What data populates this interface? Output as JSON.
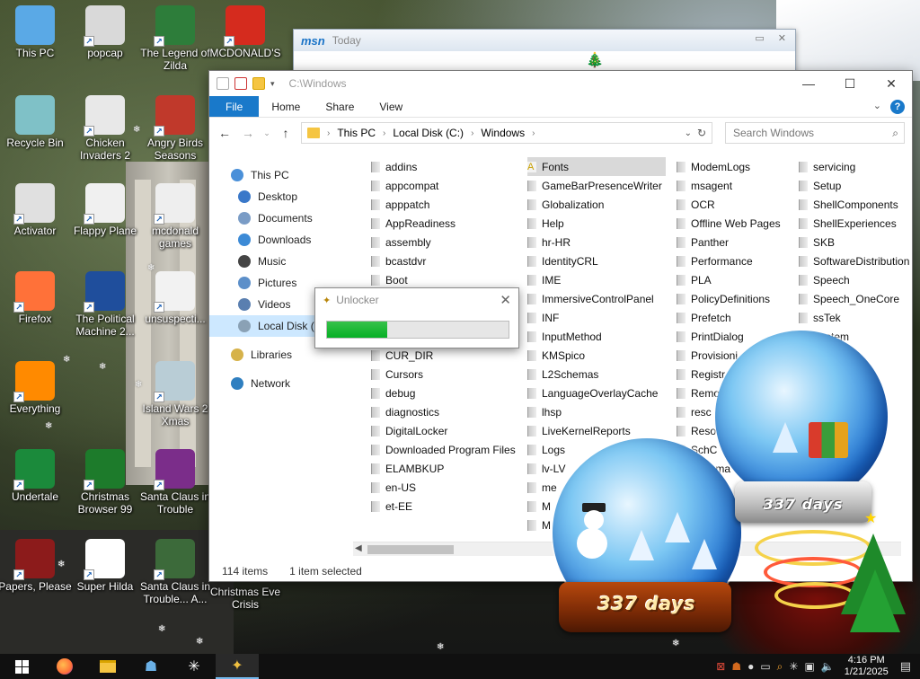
{
  "desktop": {
    "icons": [
      {
        "label": "This PC",
        "icon": "computer-icon",
        "color": "#5aa9e6"
      },
      {
        "label": "popcap",
        "icon": "folder-icon",
        "color": "#d9d9d9"
      },
      {
        "label": "The Legend of Zilda",
        "icon": "game-icon",
        "color": "#2d7d3a"
      },
      {
        "label": "MCDONALD'S",
        "icon": "mcdonalds-icon",
        "color": "#d52b1e"
      },
      {
        "label": "Recycle Bin",
        "icon": "recycle-bin-icon",
        "color": "#7fc1c7"
      },
      {
        "label": "Chicken Invaders 2",
        "icon": "chicken-icon",
        "color": "#e8e8e8"
      },
      {
        "label": "Angry Birds Seasons",
        "icon": "angry-bird-icon",
        "color": "#c0392b"
      },
      {
        "label": "Activator",
        "icon": "file-icon",
        "color": "#e0e0e0"
      },
      {
        "label": "Flappy Plane",
        "icon": "plane-icon",
        "color": "#f0f0f0"
      },
      {
        "label": "mcdonald games",
        "icon": "file-icon",
        "color": "#eeeeee"
      },
      {
        "label": "Firefox",
        "icon": "firefox-icon",
        "color": "#ff7139"
      },
      {
        "label": "The Political Machine 2...",
        "icon": "political-machine-icon",
        "color": "#1f4e9c"
      },
      {
        "label": "unsuspecti...",
        "icon": "file-icon",
        "color": "#f2f2f2"
      },
      {
        "label": "Everything",
        "icon": "everything-icon",
        "color": "#ff8a00"
      },
      {
        "label": "Island Wars 2 Xmas",
        "icon": "island-icon",
        "color": "#b9cdd6"
      },
      {
        "label": "Undertale",
        "icon": "undertale-icon",
        "color": "#1b8a3b"
      },
      {
        "label": "Christmas Browser 99",
        "icon": "christmas-tree-icon",
        "color": "#1d7b2b"
      },
      {
        "label": "Santa Claus in Trouble",
        "icon": "santa-icon",
        "color": "#7b2d8a"
      },
      {
        "label": "Papers, Please",
        "icon": "papers-please-icon",
        "color": "#8c1b1b"
      },
      {
        "label": "Super Hilda",
        "icon": "pixel-icon",
        "color": "#ffffff"
      },
      {
        "label": "Santa Claus in Trouble... A...",
        "icon": "santa-icon",
        "color": "#3c6a3a"
      },
      {
        "label": "Christmas Eve Crisis",
        "icon": "",
        "color": ""
      }
    ]
  },
  "msn": {
    "logo": "msn",
    "title": "Today"
  },
  "explorer": {
    "title_path": "C:\\Windows",
    "ribbon_tabs": [
      "File",
      "Home",
      "Share",
      "View"
    ],
    "address_parts": [
      "This PC",
      "Local Disk (C:)",
      "Windows"
    ],
    "search_placeholder": "Search Windows",
    "nav": [
      {
        "label": "This PC",
        "icon": "computer-icon",
        "color": "#4a90d9"
      },
      {
        "label": "Desktop",
        "icon": "desktop-icon",
        "color": "#3a78c9"
      },
      {
        "label": "Documents",
        "icon": "documents-icon",
        "color": "#7a9cc6"
      },
      {
        "label": "Downloads",
        "icon": "downloads-icon",
        "color": "#3c8ad6"
      },
      {
        "label": "Music",
        "icon": "music-icon",
        "color": "#444444"
      },
      {
        "label": "Pictures",
        "icon": "pictures-icon",
        "color": "#5c8fc9"
      },
      {
        "label": "Videos",
        "icon": "videos-icon",
        "color": "#5a7fb0"
      },
      {
        "label": "Local Disk (C:)",
        "icon": "disk-icon",
        "color": "#8aa1b5"
      },
      {
        "label": "Libraries",
        "icon": "libraries-icon",
        "color": "#d6b24a"
      },
      {
        "label": "Network",
        "icon": "network-icon",
        "color": "#2f7fc0"
      }
    ],
    "columns": [
      [
        "addins",
        "appcompat",
        "apppatch",
        "AppReadiness",
        "assembly",
        "bcastdvr",
        "Boot",
        "",
        "",
        "CSC",
        "CUR_DIR",
        "Cursors",
        "debug",
        "diagnostics",
        "DigitalLocker",
        "Downloaded Program Files",
        "ELAMBKUP",
        "en-US",
        "et-EE"
      ],
      [
        "Fonts",
        "GameBarPresenceWriter",
        "Globalization",
        "Help",
        "hr-HR",
        "IdentityCRL",
        "IME",
        "ImmersiveControlPanel",
        "INF",
        "InputMethod",
        "KMSpico",
        "L2Schemas",
        "LanguageOverlayCache",
        "lhsp",
        "LiveKernelReports",
        "Logs",
        "lv-LV",
        "me",
        "M",
        "M"
      ],
      [
        "ModemLogs",
        "msagent",
        "OCR",
        "Offline Web Pages",
        "Panther",
        "Performance",
        "PLA",
        "PolicyDefinitions",
        "Prefetch",
        "PrintDialog",
        "Provisioni",
        "Registr",
        "Remo",
        "resc",
        "Reso",
        "SchC",
        "Schema",
        "ty",
        "tate"
      ],
      [
        "servicing",
        "Setup",
        "ShellComponents",
        "ShellExperiences",
        "SKB",
        "SoftwareDistribution",
        "Speech",
        "Speech_OneCore",
        "ssTek",
        "System",
        "",
        "",
        "ces"
      ]
    ],
    "selected_item": "Fonts",
    "status_count": "114 items",
    "status_selected": "1 item selected"
  },
  "unlocker": {
    "title": "Unlocker",
    "progress": 0.33
  },
  "globes": {
    "left_days": "337 days",
    "right_days": "337 days"
  },
  "taskbar": {
    "items": [
      "start-icon",
      "firefox-icon",
      "file-explorer-icon",
      "app-icon",
      "snowflake-icon",
      "unlocker-icon"
    ],
    "time": "4:16 PM",
    "date": "1/21/2025"
  },
  "colors": {
    "accent": "#1979ca",
    "progress": "#06b025",
    "selection": "#cde8ff"
  }
}
